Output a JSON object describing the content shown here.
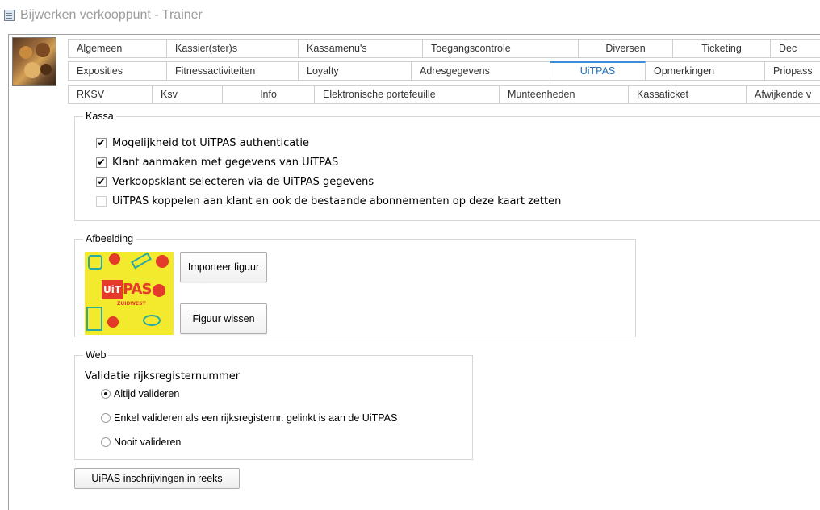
{
  "window": {
    "title": "Bijwerken verkooppunt - Trainer",
    "icon": "form-icon"
  },
  "tabs": {
    "row1": [
      "Algemeen",
      "Kassier(ster)s",
      "Kassamenu's",
      "Toegangscontrole",
      "Diversen",
      "Ticketing",
      "Dec"
    ],
    "row2": [
      "Exposities",
      "Fitnessactiviteiten",
      "Loyalty",
      "Adresgegevens",
      "UiTPAS",
      "Opmerkingen",
      "Priopass"
    ],
    "row3": [
      "RKSV",
      "Ksv",
      "Info",
      "Elektronische portefeuille",
      "Munteenheden",
      "Kassaticket",
      "Afwijkende v"
    ],
    "active": "UiTPAS",
    "active_color": "#1e6fbf"
  },
  "kassa": {
    "label": "Kassa",
    "options": [
      {
        "label": "Mogelijkheid tot UiTPAS authenticatie",
        "checked": true
      },
      {
        "label": "Klant aanmaken met gegevens van UiTPAS",
        "checked": true
      },
      {
        "label": "Verkoopsklant selecteren via de UiTPAS gegevens",
        "checked": true
      },
      {
        "label": "UiTPAS koppelen aan klant en ook de bestaande abonnementen op deze kaart zetten",
        "checked": false
      }
    ],
    "check_mark": "✔"
  },
  "afbeelding": {
    "label": "Afbeelding",
    "logo_left": "UiT",
    "logo_right": "PAS",
    "logo_sub": "ZUIDWEST",
    "import_button": "Importeer figuur",
    "clear_button": "Figuur wissen"
  },
  "web": {
    "label": "Web",
    "title": "Validatie rijksregisternummer",
    "options": [
      {
        "label": "Altijd valideren",
        "selected": true
      },
      {
        "label": "Enkel valideren als een rijksregisternr. gelinkt is aan de UiTPAS",
        "selected": false
      },
      {
        "label": "Nooit valideren",
        "selected": false
      }
    ]
  },
  "series_button": "UiPAS inschrijvingen in reeks"
}
